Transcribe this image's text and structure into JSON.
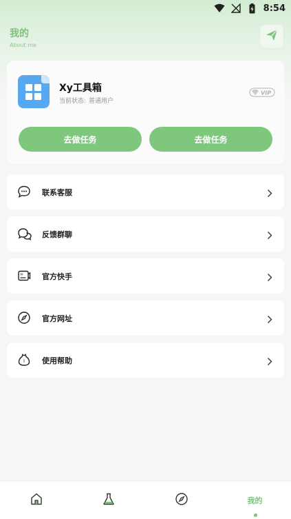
{
  "status_bar": {
    "time": "8:54",
    "icons": [
      "wifi-icon",
      "signal-off-icon",
      "battery-charging-icon"
    ]
  },
  "header": {
    "title": "我的",
    "subtitle": "About me",
    "action_icon": "send-icon"
  },
  "profile": {
    "app_name": "Xy工具箱",
    "status_label": "当前状态:",
    "status_value": "普通用户",
    "badge": "VIP",
    "task_buttons": [
      "去做任务",
      "去做任务"
    ]
  },
  "menu": [
    {
      "label": "联系客服",
      "icon": "chat-bubble-icon"
    },
    {
      "label": "反馈群聊",
      "icon": "group-chat-icon"
    },
    {
      "label": "官方快手",
      "icon": "video-card-icon"
    },
    {
      "label": "官方网址",
      "icon": "compass-icon"
    },
    {
      "label": "使用帮助",
      "icon": "help-bag-icon"
    }
  ],
  "bottom_nav": {
    "tabs": [
      {
        "icon": "home-icon"
      },
      {
        "icon": "flask-icon"
      },
      {
        "icon": "compass-icon"
      },
      {
        "label": "我的",
        "active": true
      }
    ]
  },
  "colors": {
    "accent": "#7fc77c",
    "title_green": "#7cc47b",
    "logo_blue": "#56a9f0"
  }
}
